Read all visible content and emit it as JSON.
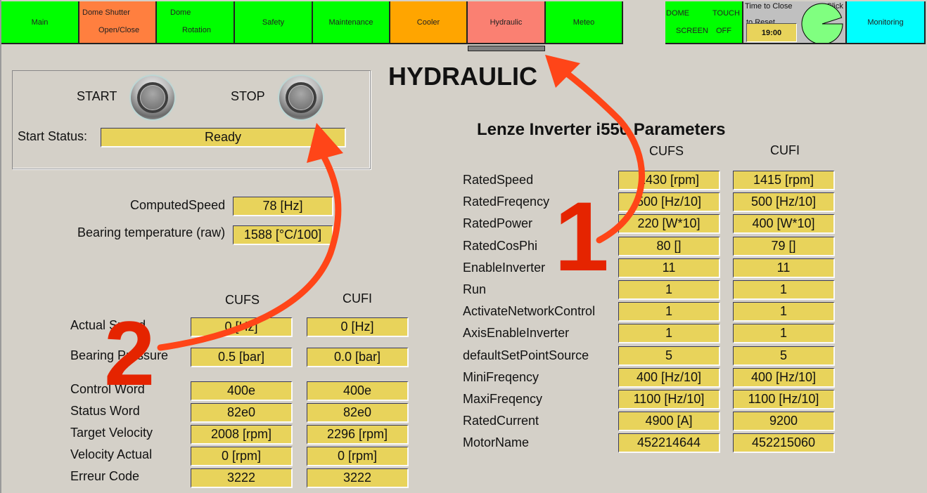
{
  "nav": {
    "main": "Main",
    "dome_shutter_l1": "Dome Shutter",
    "dome_shutter_l2": "Open/Close",
    "dome_rotation_l1": "Dome",
    "dome_rotation_l2": "Rotation",
    "safety": "Safety",
    "maintenance": "Maintenance",
    "cooler": "Cooler",
    "hydraulic": "Hydraulic",
    "meteo": "Meteo",
    "touch_l1a": "DOME",
    "touch_l1b": "TOUCH",
    "touch_l2a": "SCREEN",
    "touch_l2b": "OFF",
    "monitoring": "Monitoring",
    "active_tab": "Hydraulic"
  },
  "timer": {
    "label": "Time to Close",
    "click_label": "Click",
    "reset_label": "to Reset",
    "value": "19:00",
    "remaining_fraction": 0.95,
    "pie_color": "#80ff80"
  },
  "colors": {
    "nav_green": "#00ff00",
    "nav_shutter": "#ff7f3f",
    "nav_cooler": "#ffa500",
    "nav_hydraulic_active": "#fa8072",
    "nav_monitoring": "#00ffff",
    "field_yellow": "#e8d35b",
    "annotation_red": "#ff4518"
  },
  "page_title": "HYDRAULIC",
  "control": {
    "start_label": "START",
    "stop_label": "STOP",
    "status_label": "Start Status:",
    "status_value": "Ready"
  },
  "computed": {
    "speed_label": "ComputedSpeed",
    "speed_value": "78 [Hz]",
    "temp_label": "Bearing temperature (raw)",
    "temp_value": "1588 [°C/100]"
  },
  "left_table": {
    "col1": "CUFS",
    "col2": "CUFI",
    "rows": [
      {
        "label": "Actual Speed",
        "cufs": "0 [Hz]",
        "cufi": "0 [Hz]"
      },
      {
        "label": "Bearing Pressure",
        "cufs": "0.5 [bar]",
        "cufi": "0.0 [bar]"
      },
      {
        "label": "Control Word",
        "cufs": "400e",
        "cufi": "400e"
      },
      {
        "label": "Status Word",
        "cufs": "82e0",
        "cufi": "82e0"
      },
      {
        "label": "Target Velocity",
        "cufs": "2008 [rpm]",
        "cufi": "2296 [rpm]"
      },
      {
        "label": "Velocity Actual",
        "cufs": "0 [rpm]",
        "cufi": "0 [rpm]"
      },
      {
        "label": "Erreur Code",
        "cufs": "3222",
        "cufi": "3222"
      }
    ]
  },
  "inverter": {
    "title": "Lenze Inverter i550 Parameters",
    "col1": "CUFS",
    "col2": "CUFI",
    "rows": [
      {
        "label": "RatedSpeed",
        "cufs": "1430 [rpm]",
        "cufi": "1415 [rpm]"
      },
      {
        "label": "RatedFreqency",
        "cufs": "500 [Hz/10]",
        "cufi": "500 [Hz/10]"
      },
      {
        "label": "RatedPower",
        "cufs": "220 [W*10]",
        "cufi": "400 [W*10]"
      },
      {
        "label": "RatedCosPhi",
        "cufs": "80 []",
        "cufi": "79 []"
      },
      {
        "label": "EnableInverter",
        "cufs": "11",
        "cufi": "11"
      },
      {
        "label": "Run",
        "cufs": "1",
        "cufi": "1"
      },
      {
        "label": "ActivateNetworkControl",
        "cufs": "1",
        "cufi": "1"
      },
      {
        "label": "AxisEnableInverter",
        "cufs": "1",
        "cufi": "1"
      },
      {
        "label": "defaultSetPointSource",
        "cufs": "5",
        "cufi": "5"
      },
      {
        "label": "MiniFreqency",
        "cufs": "400 [Hz/10]",
        "cufi": "400 [Hz/10]"
      },
      {
        "label": "MaxiFreqency",
        "cufs": "1100 [Hz/10]",
        "cufi": "1100 [Hz/10]"
      },
      {
        "label": "RatedCurrent",
        "cufs": "4900 [A]",
        "cufi": "9200"
      },
      {
        "label": "MotorName",
        "cufs": "452214644",
        "cufi": "452215060"
      }
    ]
  },
  "annotations": {
    "marker_1": "1",
    "marker_2": "2"
  }
}
